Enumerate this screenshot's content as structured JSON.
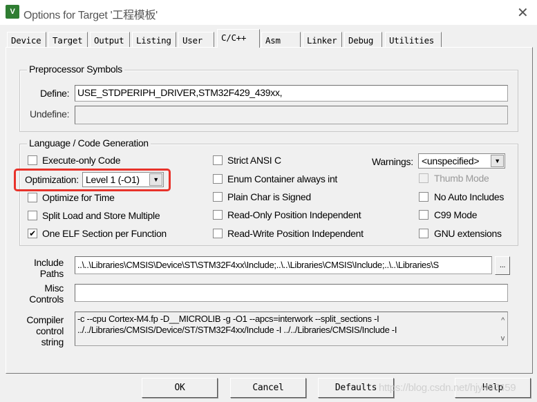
{
  "window": {
    "title": "Options for Target '工程模板'",
    "icon": "uvision-icon",
    "close": "✕"
  },
  "tabs": [
    {
      "label": "Device"
    },
    {
      "label": "Target"
    },
    {
      "label": "Output"
    },
    {
      "label": "Listing"
    },
    {
      "label": "User"
    },
    {
      "label": "C/C++",
      "active": true
    },
    {
      "label": "Asm"
    },
    {
      "label": "Linker"
    },
    {
      "label": "Debug"
    },
    {
      "label": "Utilities"
    }
  ],
  "preprocessor": {
    "title": "Preprocessor Symbols",
    "define_label": "Define:",
    "define_value": "USE_STDPERIPH_DRIVER,STM32F429_439xx,",
    "undefine_label": "Undefine:",
    "undefine_value": ""
  },
  "codegen": {
    "title": "Language / Code Generation",
    "execute_only": {
      "label": "Execute-only Code",
      "checked": false
    },
    "optimization_label": "Optimization:",
    "optimization_value": "Level 1 (-O1)",
    "optimize_time": {
      "label": "Optimize for Time",
      "checked": false
    },
    "split_load": {
      "label": "Split Load and Store Multiple",
      "checked": false
    },
    "one_elf": {
      "label": "One ELF Section per Function",
      "checked": true
    },
    "strict_ansi": {
      "label": "Strict ANSI C",
      "checked": false
    },
    "enum_int": {
      "label": "Enum Container always int",
      "checked": false
    },
    "plain_char": {
      "label": "Plain Char is Signed",
      "checked": false
    },
    "ro_pi": {
      "label": "Read-Only Position Independent",
      "checked": false
    },
    "rw_pi": {
      "label": "Read-Write Position Independent",
      "checked": false
    },
    "warnings_label": "Warnings:",
    "warnings_value": "<unspecified>",
    "thumb_mode": {
      "label": "Thumb Mode",
      "checked": false,
      "disabled": true
    },
    "no_auto_includes": {
      "label": "No Auto Includes",
      "checked": false
    },
    "c99": {
      "label": "C99 Mode",
      "checked": false
    },
    "gnu_ext": {
      "label": "GNU extensions",
      "checked": false
    }
  },
  "include": {
    "label_line1": "Include",
    "label_line2": "Paths",
    "value": "..\\..\\Libraries\\CMSIS\\Device\\ST\\STM32F4xx\\Include;..\\..\\Libraries\\CMSIS\\Include;..\\..\\Libraries\\S",
    "browse": "..."
  },
  "misc": {
    "label_line1": "Misc",
    "label_line2": "Controls",
    "value": ""
  },
  "compiler": {
    "label_line1": "Compiler",
    "label_line2": "control",
    "label_line3": "string",
    "line1": "-c --cpu Cortex-M4.fp -D__MICROLIB -g -O1 --apcs=interwork --split_sections -I",
    "line2": "../../Libraries/CMSIS/Device/ST/STM32F4xx/Include -I ../../Libraries/CMSIS/Include -I",
    "scroll_up": "^",
    "scroll_down": "v"
  },
  "buttons": {
    "ok": "OK",
    "cancel": "Cancel",
    "defaults": "Defaults",
    "help": "Help"
  },
  "watermark": "https://blog.csdn.net/hjy457459",
  "colors": {
    "highlight": "#e8322a"
  }
}
